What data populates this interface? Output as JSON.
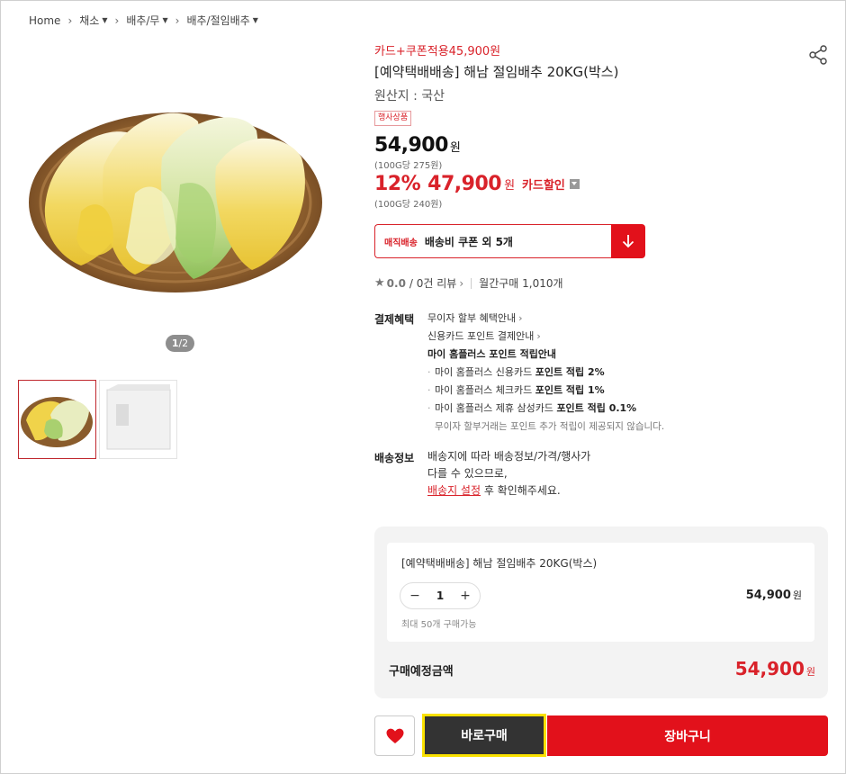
{
  "breadcrumb": {
    "home": "Home",
    "items": [
      "채소",
      "배추/무",
      "배추/절임배추"
    ]
  },
  "gallery": {
    "pager_current": "1",
    "pager_total": "/2"
  },
  "product": {
    "promo": "카드+쿠폰적용45,900원",
    "title": "[예약택배배송] 해남 절임배추 20KG(박스)",
    "origin": "원산지 : 국산",
    "event_badge": "행사상품",
    "price": "54,900",
    "won": "원",
    "unit_price": "(100G당 275원)",
    "discount_rate": "12%",
    "card_price": "47,900",
    "card_label": "카드할인",
    "card_unit_price": "(100G당 240원)"
  },
  "coupon": {
    "tag": "매직배송",
    "text": "배송비 쿠폰 외 5개"
  },
  "review": {
    "score": "0.0",
    "count": "/ 0건 리뷰",
    "monthly": "월간구매 1,010개"
  },
  "benefit": {
    "title": "결제혜택",
    "lines": [
      "무이자 할부 혜택안내",
      "신용카드 포인트 결제안내",
      "마이 홈플러스 포인트 적립안내"
    ],
    "subs": [
      {
        "pre": "마이 홈플러스 신용카드 ",
        "bold": "포인트 적립 2%"
      },
      {
        "pre": "마이 홈플러스 체크카드 ",
        "bold": "포인트 적립 1%"
      },
      {
        "pre": "마이 홈플러스 제휴 삼성카드 ",
        "bold": "포인트 적립 0.1%"
      }
    ],
    "note": "무이자 할부거래는 포인트 추가 적립이 제공되지 않습니다."
  },
  "shipping": {
    "title": "배송정보",
    "line1": "배송지에 따라 배송정보/가격/행사가",
    "line2": "다를 수 있으므로,",
    "link": "배송지 설정",
    "line3_rest": " 후 확인해주세요."
  },
  "panel": {
    "name": "[예약택배배송] 해남 절임배추 20KG(박스)",
    "qty_minus": "−",
    "qty_value": "1",
    "qty_plus": "+",
    "line_price": "54,900",
    "won": "원",
    "max_note": "최대 50개 구매가능",
    "total_label": "구매예정금액",
    "total_price": "54,900"
  },
  "actions": {
    "buy_now": "바로구매",
    "cart": "장바구니"
  },
  "colors": {
    "accent_red": "#e2111b",
    "highlight_yellow": "#fae100"
  }
}
